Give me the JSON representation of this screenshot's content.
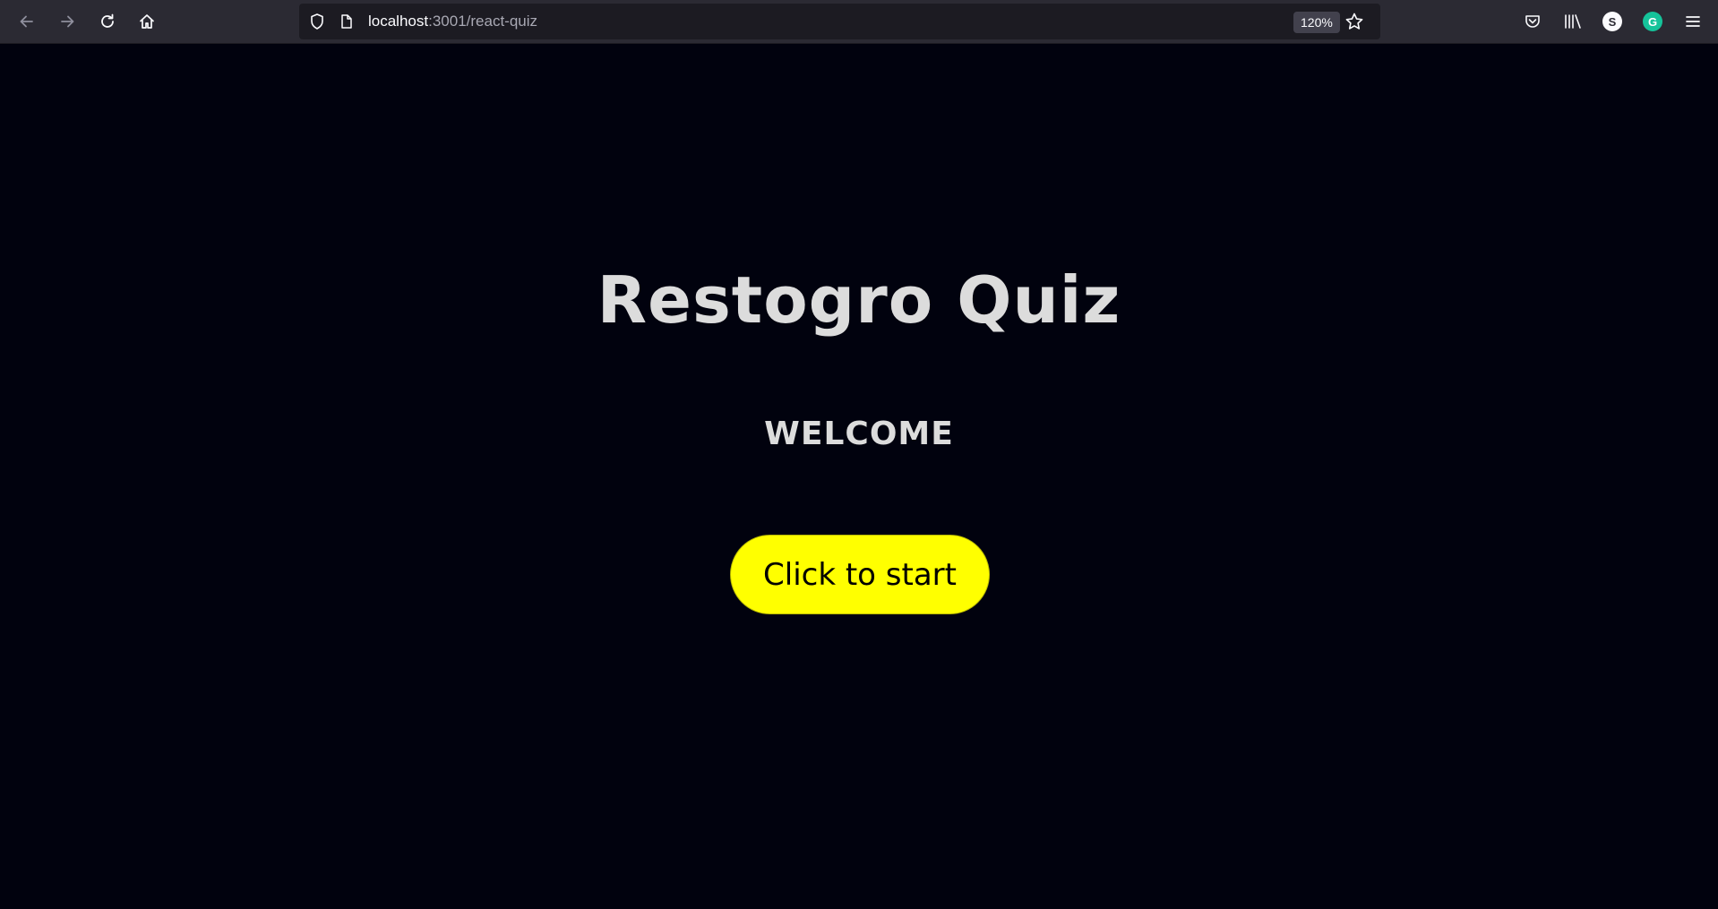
{
  "browser": {
    "url_host": "localhost",
    "url_path": ":3001/react-quiz",
    "zoom": "120%",
    "extension_s_letter": "S",
    "extension_g_letter": "G"
  },
  "page": {
    "title": "Restogro Quiz",
    "subtitle": "WELCOME",
    "start_button_label": "Click to start"
  },
  "colors": {
    "background": "#01020e",
    "toolbar": "#2b2a33",
    "button": "#ffff00",
    "heading_text": "#dcdcdc",
    "grammarly_green": "#15c39a"
  }
}
